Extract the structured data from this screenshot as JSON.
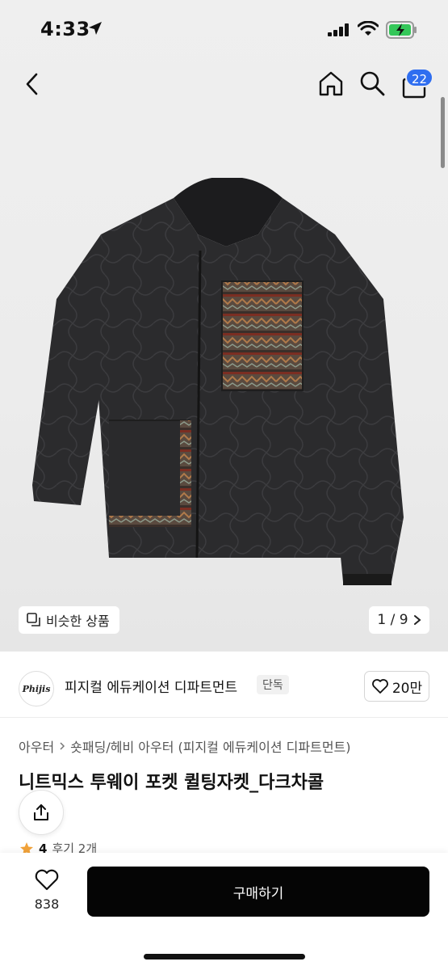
{
  "status_bar": {
    "time": "4:33"
  },
  "nav": {
    "cart_count": "22"
  },
  "gallery": {
    "similar_label": "비슷한 상품",
    "pager": "1 / 9"
  },
  "brand": {
    "logo_text": "Phijis",
    "name": "피지컬 에듀케이션 디파트먼트",
    "tag": "단독",
    "likes": "20만"
  },
  "breadcrumb": {
    "level1": "아우터",
    "level2": "숏패딩/헤비 아우터 (피지컬 에듀케이션 디파트먼트)"
  },
  "product": {
    "title": "니트믹스 투웨이 포켓 퀼팅자켓_다크차콜",
    "rating": "4",
    "reviews": "후기 2개"
  },
  "bottom_bar": {
    "wish_count": "838",
    "buy_label": "구매하기"
  },
  "colors": {
    "accent": "#2f6ef0",
    "buy_button": "#050505",
    "star": "#f2a33a",
    "hero_bg": "#ececec"
  }
}
